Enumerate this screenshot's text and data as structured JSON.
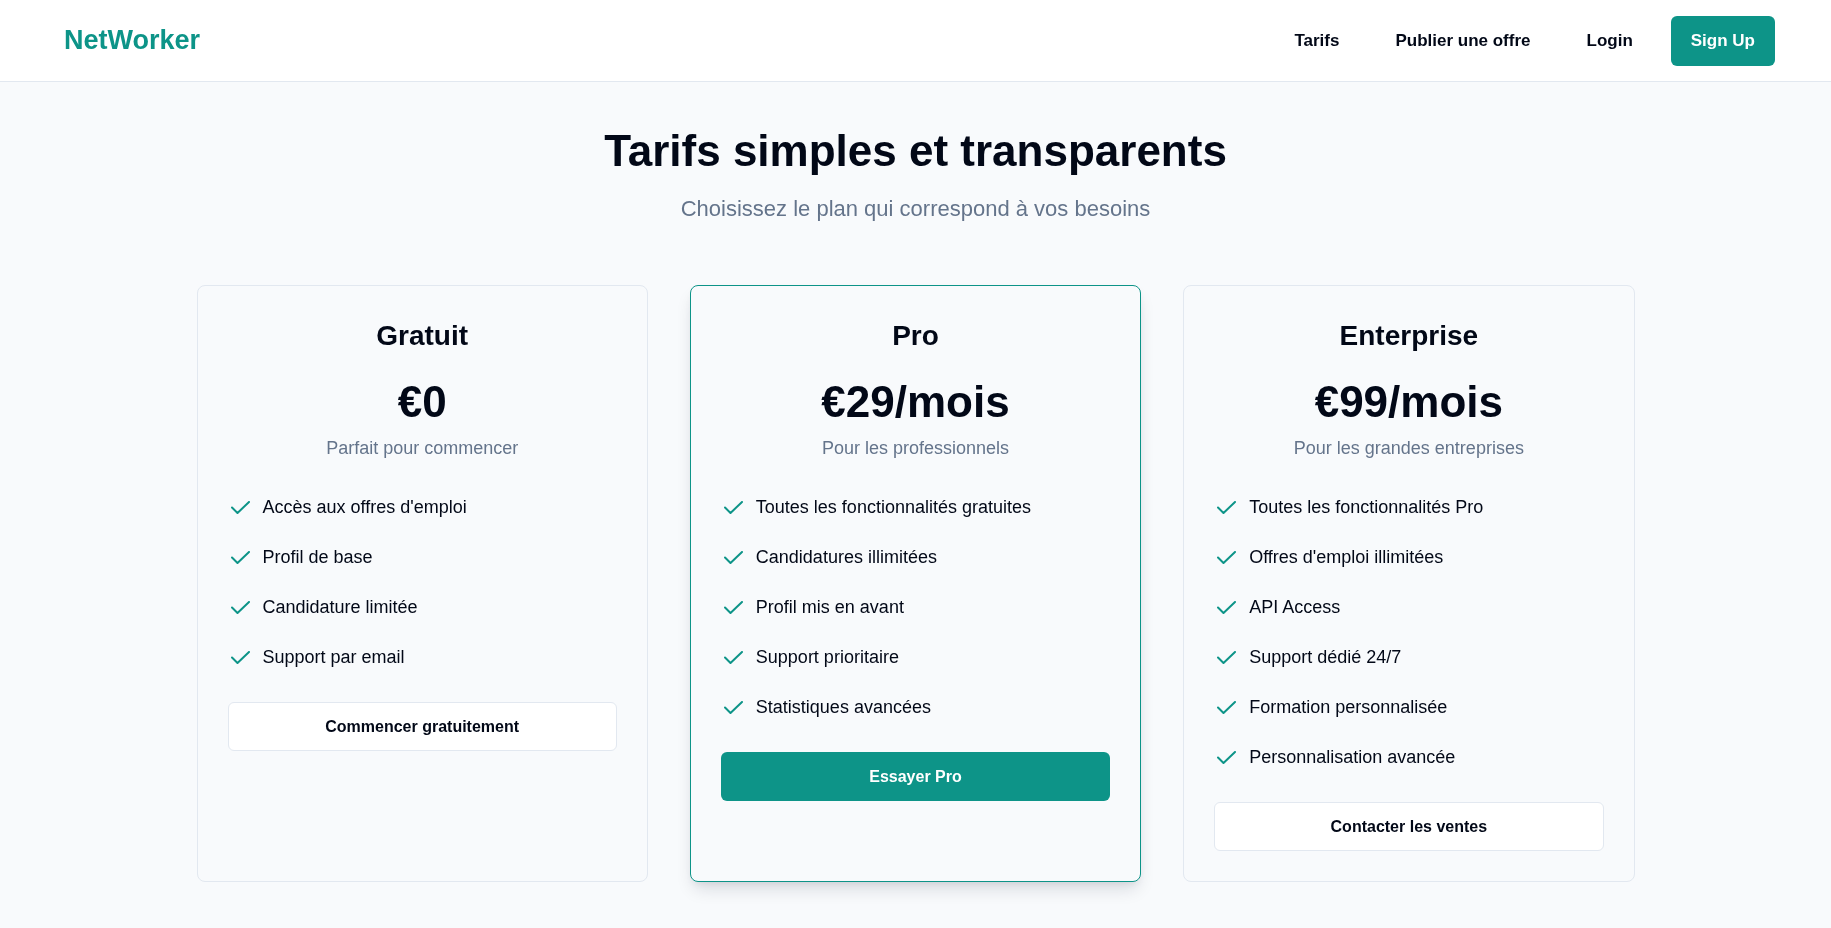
{
  "header": {
    "logo": "NetWorker",
    "nav": [
      {
        "label": "Tarifs",
        "kind": "link"
      },
      {
        "label": "Publier une offre",
        "kind": "link"
      },
      {
        "label": "Login",
        "kind": "link"
      },
      {
        "label": "Sign Up",
        "kind": "button"
      }
    ]
  },
  "hero": {
    "title": "Tarifs simples et transparents",
    "subtitle": "Choisissez le plan qui correspond à vos besoins"
  },
  "plans": [
    {
      "name": "Gratuit",
      "price": "€0",
      "tagline": "Parfait pour commencer",
      "highlighted": false,
      "features": [
        "Accès aux offres d'emploi",
        "Profil de base",
        "Candidature limitée",
        "Support par email"
      ],
      "cta": {
        "label": "Commencer gratuitement",
        "kind": "outline"
      }
    },
    {
      "name": "Pro",
      "price": "€29/mois",
      "tagline": "Pour les professionnels",
      "highlighted": true,
      "features": [
        "Toutes les fonctionnalités gratuites",
        "Candidatures illimitées",
        "Profil mis en avant",
        "Support prioritaire",
        "Statistiques avancées"
      ],
      "cta": {
        "label": "Essayer Pro",
        "kind": "primary"
      }
    },
    {
      "name": "Enterprise",
      "price": "€99/mois",
      "tagline": "Pour les grandes entreprises",
      "highlighted": false,
      "features": [
        "Toutes les fonctionnalités Pro",
        "Offres d'emploi illimitées",
        "API Access",
        "Support dédié 24/7",
        "Formation personnalisée",
        "Personnalisation avancée"
      ],
      "cta": {
        "label": "Contacter les ventes",
        "kind": "outline"
      }
    }
  ]
}
